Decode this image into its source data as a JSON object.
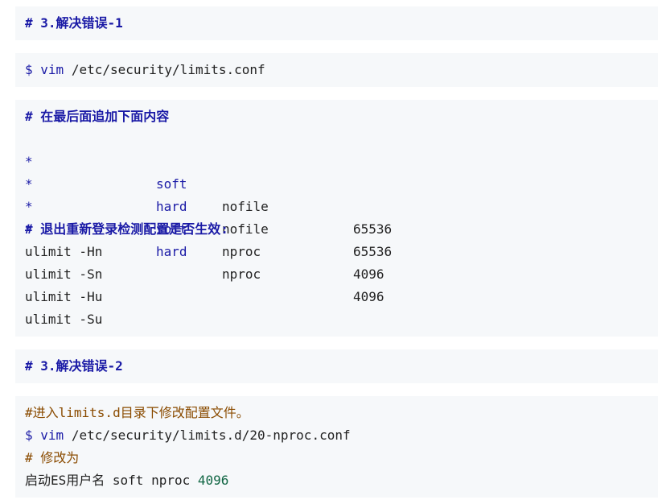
{
  "block1": {
    "heading": "# 3.解决错误-1"
  },
  "block2": {
    "prompt": "$",
    "cmd": "vim",
    "args": " /etc/security/limits.conf"
  },
  "block3": {
    "comment1": "# 在最后面追加下面内容",
    "rows": [
      {
        "domain": "*",
        "type": "soft",
        "item": "nofile",
        "value": "65536"
      },
      {
        "domain": "*",
        "type": "hard",
        "item": "nofile",
        "value": "65536"
      },
      {
        "domain": "*",
        "type": "soft",
        "item": "nproc",
        "value": "4096"
      },
      {
        "domain": "*",
        "type": "hard",
        "item": "nproc",
        "value": "4096"
      }
    ],
    "comment2": "# 退出重新登录检测配置是否生效:",
    "commands": [
      "ulimit -Hn",
      "ulimit -Sn",
      "ulimit -Hu",
      "ulimit -Su"
    ]
  },
  "block4": {
    "heading": "# 3.解决错误-2"
  },
  "block5": {
    "comment1": "#进入limits.d目录下修改配置文件。",
    "prompt": "$",
    "cmd": "vim",
    "args": " /etc/security/limits.d/20-nproc.conf",
    "comment2": "# 修改为",
    "line_prefix": "启动ES用户名 soft nproc ",
    "line_value": "4096"
  },
  "colors": {
    "code_bg": "#f6f8fa",
    "comment": "#1a1aa6",
    "comment_alt": "#8a4b00",
    "number": "#116644"
  }
}
